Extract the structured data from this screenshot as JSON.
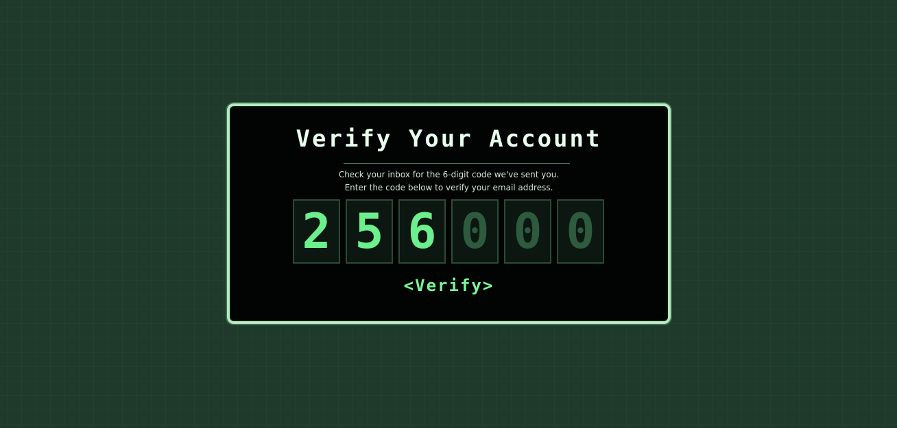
{
  "card": {
    "title": "Verify Your Account",
    "line1": "Check your inbox for the 6-digit code we've sent you.",
    "line2": "Enter the code below to verify your email address."
  },
  "code": {
    "digits": [
      "2",
      "5",
      "6",
      "0",
      "0",
      "0"
    ],
    "filled": [
      true,
      true,
      true,
      false,
      false,
      false
    ]
  },
  "actions": {
    "verify_label": "Verify",
    "left_bracket": "<",
    "right_bracket": ">"
  },
  "colors": {
    "accent": "#6cf08e",
    "border": "#b8e8c4",
    "background": "#050806"
  }
}
